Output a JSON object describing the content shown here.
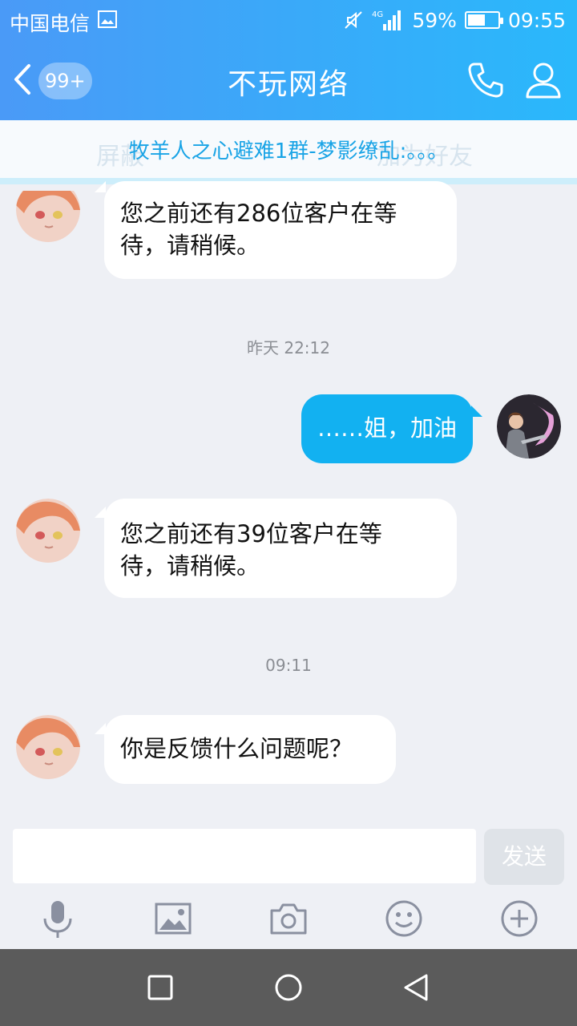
{
  "status_bar": {
    "carrier": "中国电信",
    "network": "4G",
    "battery_percent": "59%",
    "battery_level": 0.59,
    "time": "09:55"
  },
  "header": {
    "unread_badge": "99+",
    "title": "不玩网络"
  },
  "notice": {
    "text": "牧羊人之心避难1群-梦影缭乱:。。。",
    "ghost_left": "屏蔽",
    "ghost_right": "加为好友"
  },
  "messages": [
    {
      "sender": "other",
      "lines": [
        "您之前还有286位客户在等",
        "待，请稍候。"
      ]
    },
    {
      "type": "time",
      "text": "昨天 22:12"
    },
    {
      "sender": "self",
      "lines": [
        "……姐，加油"
      ]
    },
    {
      "sender": "other",
      "lines": [
        "您之前还有39位客户在等",
        "待，请稍候。"
      ]
    },
    {
      "type": "time",
      "text": "09:11"
    },
    {
      "sender": "other",
      "lines": [
        "你是反馈什么问题呢？"
      ]
    }
  ],
  "composer": {
    "input_value": "",
    "send_label": "发送"
  },
  "toolbar": [
    "microphone-icon",
    "image-icon",
    "camera-icon",
    "emoji-icon",
    "plus-icon"
  ],
  "colors": {
    "header_start": "#4a9af7",
    "header_end": "#2ab8fb",
    "self_bubble": "#12b1f1",
    "notice_text": "#1aa4e6"
  }
}
